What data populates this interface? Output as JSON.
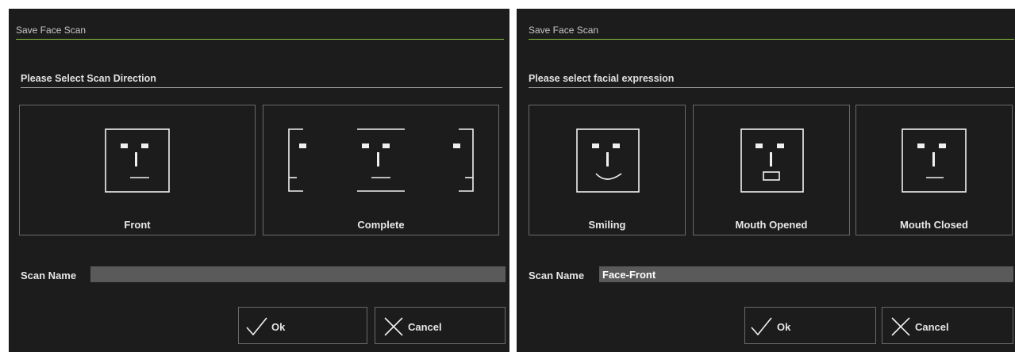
{
  "left": {
    "title": "Save Face Scan",
    "section": "Please Select Scan Direction",
    "options": [
      {
        "label": "Front"
      },
      {
        "label": "Complete"
      }
    ],
    "scan_name_label": "Scan Name",
    "scan_name_value": "",
    "ok_label": "Ok",
    "cancel_label": "Cancel"
  },
  "right": {
    "title": "Save Face Scan",
    "section": "Please select facial expression",
    "options": [
      {
        "label": "Smiling"
      },
      {
        "label": "Mouth Opened"
      },
      {
        "label": "Mouth Closed"
      }
    ],
    "scan_name_label": "Scan Name",
    "scan_name_value": "Face-Front",
    "ok_label": "Ok",
    "cancel_label": "Cancel"
  },
  "icons": [
    "face-front-icon",
    "face-complete-icon",
    "face-smiling-icon",
    "face-mouth-opened-icon",
    "face-mouth-closed-icon",
    "checkmark-icon",
    "close-x-icon"
  ],
  "colors": {
    "background": "#1c1c1c",
    "title_underline": "#8fc13a",
    "input_background": "#5a5a5a"
  }
}
